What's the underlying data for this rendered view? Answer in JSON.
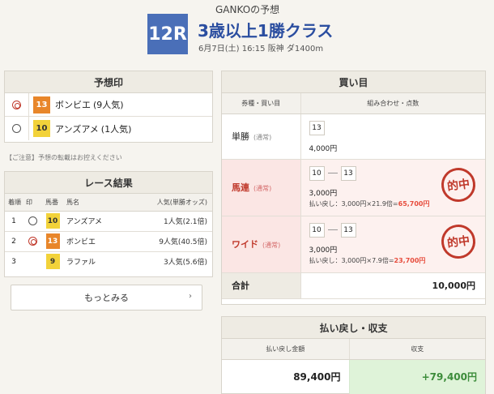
{
  "header": {
    "predictor": "GANKOの予想",
    "race_no": "12R",
    "race_name": "3歳以上1勝クラス",
    "meta": "6月7日(土) 16:15 阪神 ダ1400m"
  },
  "prediction": {
    "title": "予想印",
    "rows": [
      {
        "mark": "double-circle",
        "num": "13",
        "color": "orange",
        "horse": "ボンビエ",
        "pop": "(9人気)"
      },
      {
        "mark": "circle",
        "num": "10",
        "color": "yellow",
        "horse": "アンズアメ",
        "pop": "(1人気)"
      }
    ]
  },
  "notice": "【ご注意】予想の転載はお控えください",
  "results": {
    "title": "レース結果",
    "headers": [
      "着順",
      "印",
      "馬番",
      "馬名",
      "人気(単勝オッズ)"
    ],
    "rows": [
      {
        "rank": "1",
        "mark": "circle",
        "num": "10",
        "color": "yellow",
        "horse": "アンズアメ",
        "pop": "1人気(2.1倍)"
      },
      {
        "rank": "2",
        "mark": "double-circle",
        "num": "13",
        "color": "orange",
        "horse": "ボンビエ",
        "pop": "9人気(40.5倍)"
      },
      {
        "rank": "3",
        "mark": "",
        "num": "9",
        "color": "yellow",
        "horse": "ラファル",
        "pop": "3人気(5.6倍)"
      }
    ],
    "more_label": "もっとみる"
  },
  "bets": {
    "title": "買い目",
    "headers": [
      "券種・買い目",
      "組み合わせ・点数"
    ],
    "rows": [
      {
        "type": "単勝",
        "sub": "(通常)",
        "combo": [
          "13"
        ],
        "amount": "4,000円",
        "hit": false,
        "return_prefix": "",
        "return_value": ""
      },
      {
        "type": "馬連",
        "sub": "(通常)",
        "combo": [
          "10",
          "13"
        ],
        "amount": "3,000円",
        "hit": true,
        "return_prefix": "払い戻し：3,000円×21.9倍=",
        "return_value": "65,700円"
      },
      {
        "type": "ワイド",
        "sub": "(通常)",
        "combo": [
          "10",
          "13"
        ],
        "amount": "3,000円",
        "hit": true,
        "return_prefix": "払い戻し：3,000円×7.9倍=",
        "return_value": "23,700円"
      }
    ],
    "total_label": "合計",
    "total_value": "10,000円",
    "stamp_label": "的中"
  },
  "payout": {
    "title": "払い戻し・収支",
    "headers": [
      "払い戻し金額",
      "収支"
    ],
    "refund": "89,400円",
    "profit": "+79,400円"
  },
  "colors": {
    "accent_blue": "#4a6fb8",
    "title_blue": "#2b4ea0",
    "hit_red": "#c0392b",
    "profit_green": "#3c8c3a"
  }
}
